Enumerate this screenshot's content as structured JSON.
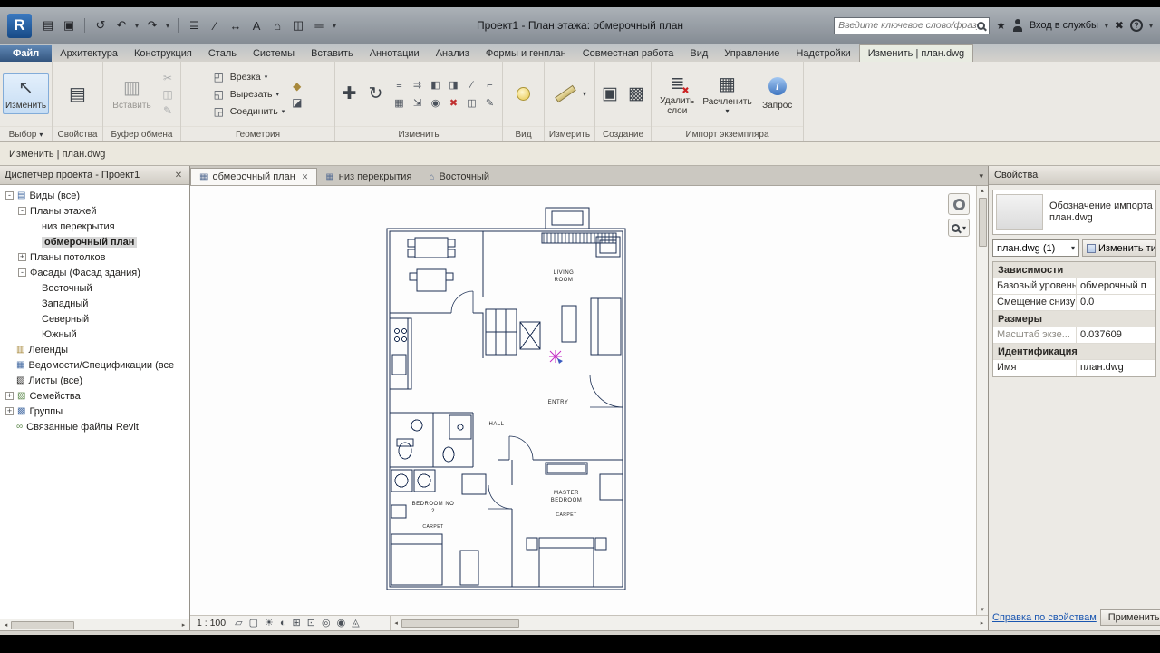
{
  "titlebar": {
    "logo": "R",
    "title": "Проект1 - План этажа: обмерочный план",
    "search_placeholder": "Введите ключевое слово/фразу",
    "sign_in": "Вход в службы",
    "qat": [
      "▤",
      "▣",
      "↺",
      "↶",
      "↷",
      "≣",
      "∕",
      "↔",
      "A",
      "⌂",
      "◫",
      "═"
    ]
  },
  "icons": {
    "caret": "▾",
    "close": "✕",
    "left": "◂",
    "right": "▸",
    "up": "▴",
    "down": "▾",
    "star": "★",
    "exchange": "✖",
    "help": "?",
    "cursor": "↖",
    "props_sheet": "▤",
    "paste": "▥",
    "cut": "✂",
    "copy": "◫",
    "match": "✎",
    "cope": "◰",
    "cut_geometry": "◱",
    "join": "◲",
    "paint": "◆",
    "demolish": "◪",
    "move": "✚",
    "rotate": "↻",
    "align": "≡",
    "offset": "⇉",
    "mirror_pick": "◧",
    "mirror_axis": "◨",
    "split": "∕",
    "trim": "⌐",
    "array": "▦",
    "scale": "⇲",
    "pin": "◉",
    "delete": "✖",
    "create_group": "▣",
    "create_similar": "▩",
    "layers": "≣",
    "explode": "▦",
    "info": "i",
    "plan_view": "▦",
    "elevation_view": "⌂",
    "tree_views": "▤",
    "tree_legends": "▥",
    "tree_schedules": "▦",
    "tree_sheets": "▧",
    "tree_families": "▨",
    "tree_groups": "▩",
    "tree_links": "∞"
  },
  "ribbon": {
    "tabs": [
      "Файл",
      "Архитектура",
      "Конструкция",
      "Сталь",
      "Системы",
      "Вставить",
      "Аннотации",
      "Анализ",
      "Формы и генплан",
      "Совместная работа",
      "Вид",
      "Управление",
      "Надстройки",
      "Изменить | план.dwg"
    ],
    "panel_labels": [
      "Выбор",
      "Свойства",
      "Буфер обмена",
      "Геометрия",
      "Изменить",
      "Вид",
      "Измерить",
      "Создание",
      "Импорт экземпляра"
    ],
    "select": {
      "modify": "Изменить"
    },
    "clipboard": {
      "paste": "Вставить"
    },
    "geometry": {
      "rows": [
        "Врезка",
        "Вырезать",
        "Соединить"
      ]
    },
    "import": {
      "buttons": [
        "Удалить слои",
        "Расчленить",
        "Запрос"
      ]
    }
  },
  "options_bar": {
    "text": "Изменить | план.dwg"
  },
  "browser": {
    "header": "Диспетчер проекта - Проект1",
    "items": [
      {
        "label": "Виды (все)",
        "exp": "-"
      },
      {
        "label": "Планы этажей",
        "exp": "-"
      },
      {
        "label": "низ перекрытия"
      },
      {
        "label": "обмерочный план",
        "selected": true
      },
      {
        "label": "Планы потолков",
        "exp": "+"
      },
      {
        "label": "Фасады (Фасад здания)",
        "exp": "-"
      },
      {
        "label": "Восточный"
      },
      {
        "label": "Западный"
      },
      {
        "label": "Северный"
      },
      {
        "label": "Южный"
      },
      {
        "label": "Легенды"
      },
      {
        "label": "Ведомости/Спецификации (все"
      },
      {
        "label": "Листы (все)"
      },
      {
        "label": "Семейства",
        "exp": "+"
      },
      {
        "label": "Группы",
        "exp": "+"
      },
      {
        "label": "Связанные файлы Revit"
      }
    ]
  },
  "view_tabs": [
    {
      "label": "обмерочный план"
    },
    {
      "label": "низ перекрытия"
    },
    {
      "label": "Восточный"
    }
  ],
  "floor_plan": {
    "labels": {
      "living_1": "LIVING",
      "living_2": "ROOM",
      "entry": "ENTRY",
      "hall": "HALL",
      "master_1": "MASTER",
      "master_2": "BEDROOM",
      "master_carpet": "CARPET",
      "bedroom2_1": "BEDROOM NO",
      "bedroom2_2": "2",
      "bedroom2_carpet": "CARPET"
    }
  },
  "properties": {
    "header": "Свойства",
    "type_label": "Обозначение импорта план.dwg",
    "type_selector": "план.dwg (1)",
    "edit_type": "Изменить ти",
    "rows": [
      {
        "label": "Зависимости"
      },
      {
        "label": "Базовый уровень",
        "value": "обмерочный п"
      },
      {
        "label": "Смещение снизу",
        "value": "0.0"
      },
      {
        "label": "Размеры"
      },
      {
        "label": "Масштаб экзе...",
        "value": "0.037609"
      },
      {
        "label": "Идентификация"
      },
      {
        "label": "Имя",
        "value": "план.dwg"
      }
    ],
    "help_link": "Справка по свойствам",
    "apply": "Применить"
  },
  "view_control": {
    "scale": "1 : 100",
    "icons": [
      {
        "name": "detail-level-icon",
        "glyph": "▱"
      },
      {
        "name": "visual-style-icon",
        "glyph": "▢"
      },
      {
        "name": "sun-path-icon",
        "glyph": "☀"
      },
      {
        "name": "shadows-icon",
        "glyph": "◐"
      },
      {
        "name": "crop-view-icon",
        "glyph": "⊞"
      },
      {
        "name": "show-crop-icon",
        "glyph": "⊡"
      },
      {
        "name": "temporary-hide-icon",
        "glyph": "◎"
      },
      {
        "name": "reveal-hidden-icon",
        "glyph": "◉"
      },
      {
        "name": "analytical-model-icon",
        "glyph": "◬"
      }
    ]
  }
}
